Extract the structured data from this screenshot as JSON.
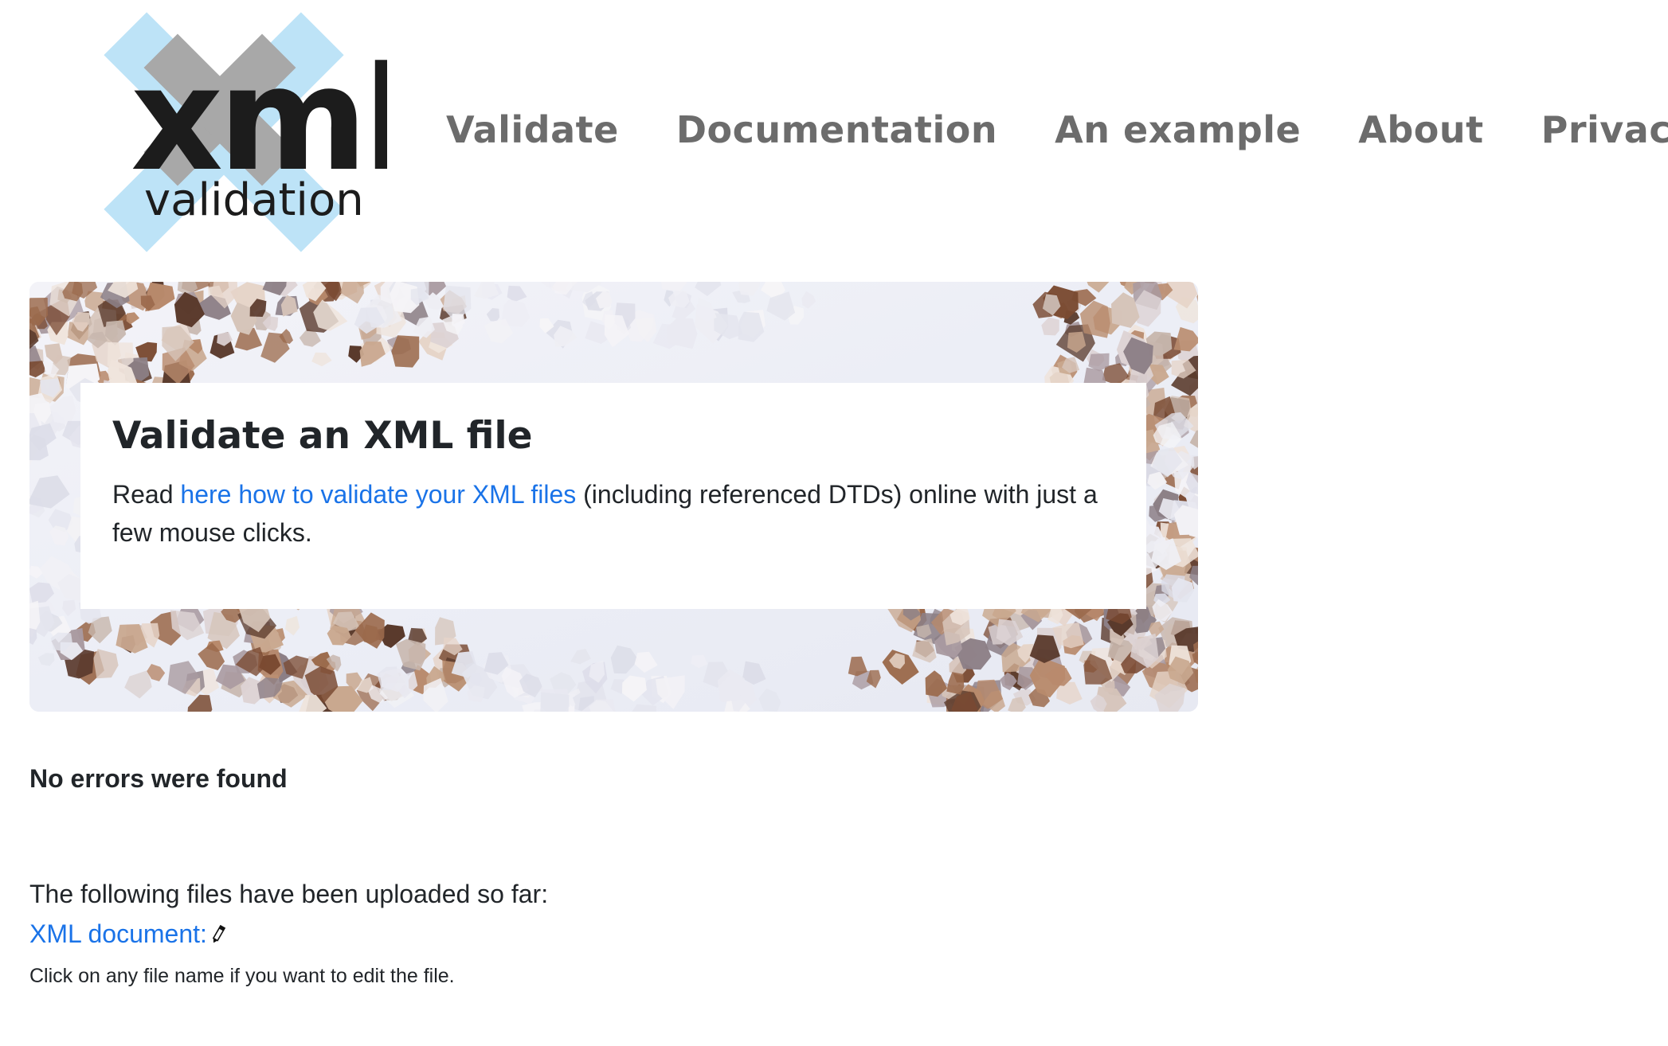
{
  "header": {
    "logo": {
      "wordmark": "xml",
      "subtitle": "validation",
      "icon": "x-cross-logo-icon"
    },
    "nav": [
      {
        "label": "Validate"
      },
      {
        "label": "Documentation"
      },
      {
        "label": "An example"
      },
      {
        "label": "About"
      },
      {
        "label": "Privacy"
      }
    ]
  },
  "hero": {
    "title": "Validate an XML file",
    "text_before": "Read ",
    "link_text": "here how to validate your XML files",
    "text_after": " (including referenced DTDs) online with just a few mouse clicks."
  },
  "results": {
    "status": "No errors were found",
    "uploaded_intro": "The following files have been uploaded so far:",
    "files": [
      {
        "name": "XML document:",
        "icon": "pencil-icon"
      }
    ],
    "edit_hint": "Click on any file name if you want to edit the file."
  },
  "colors": {
    "link": "#1a73e8",
    "nav": "#6c6c6c",
    "text": "#212529",
    "logo_cross_light": "#bde3f7",
    "logo_cross_dark": "#a8a8a8",
    "logo_text": "#1c1c1c"
  }
}
